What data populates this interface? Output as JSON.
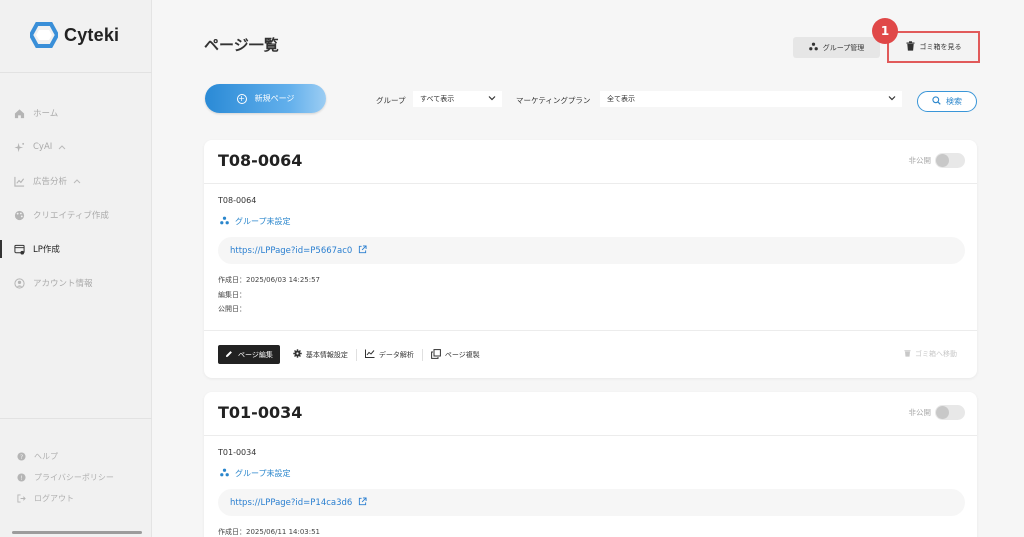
{
  "brand": {
    "name": "Cyteki"
  },
  "sidebar": {
    "items": [
      {
        "label": "ホーム",
        "icon": "home-icon"
      },
      {
        "label": "CyAI",
        "icon": "sparkle-icon",
        "chevron": "^"
      },
      {
        "label": "広告分析",
        "icon": "chart-icon",
        "chevron": "^"
      },
      {
        "label": "クリエイティブ作成",
        "icon": "palette-icon"
      },
      {
        "label": "LP作成",
        "icon": "lp-icon",
        "active": true
      },
      {
        "label": "アカウント情報",
        "icon": "user-icon"
      }
    ],
    "footer": [
      {
        "label": "ヘルプ",
        "icon": "help-icon"
      },
      {
        "label": "プライバシーポリシー",
        "icon": "info-icon"
      },
      {
        "label": "ログアウト",
        "icon": "logout-icon"
      }
    ]
  },
  "header": {
    "title": "ページ一覧",
    "group_manage_label": "グループ管理",
    "trash_label": "ゴミ箱を見る",
    "step_badge": "1"
  },
  "toolbar": {
    "new_page_label": "新規ページ",
    "group_filter_label": "グループ",
    "group_filter_value": "すべて表示",
    "plan_filter_label": "マーケティングプラン",
    "plan_filter_value": "全て表示",
    "search_label": "検索"
  },
  "cards": [
    {
      "title": "T08-0064",
      "visibility_label": "非公開",
      "name": "T08-0064",
      "group": "グループ未設定",
      "url": "https://LPPage?id=P5667ac0",
      "created": "作成日：2025/06/03 14:25:57",
      "edited": "編集日：",
      "published": "公開日：",
      "actions": {
        "edit": "ページ編集",
        "settings": "基本情報設定",
        "analytics": "データ解析",
        "duplicate": "ページ複製",
        "trash": "ゴミ箱へ移動"
      }
    },
    {
      "title": "T01-0034",
      "visibility_label": "非公開",
      "name": "T01-0034",
      "group": "グループ未設定",
      "url": "https://LPPage?id=P14ca3d6",
      "created": "作成日：2025/06/11 14:03:51"
    }
  ],
  "colors": {
    "accent": "#2a86cc",
    "highlight": "#e15a5a",
    "badge": "#e04848"
  }
}
